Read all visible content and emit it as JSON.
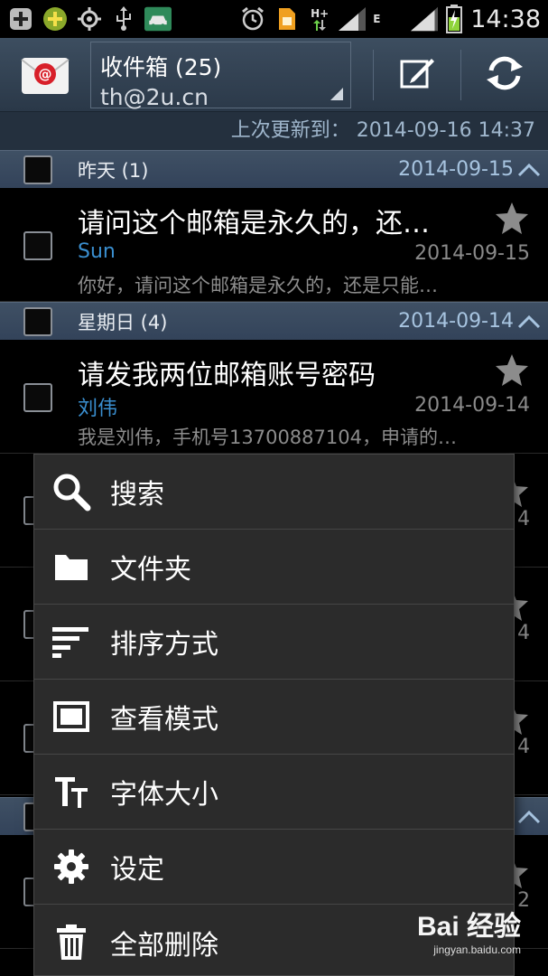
{
  "status_bar": {
    "time": "14:38",
    "network_type": "H+",
    "network_type2": "E"
  },
  "header": {
    "folder_title": "收件箱 (25)",
    "email": "th@2u.cn"
  },
  "last_updated": "上次更新到： 2014-09-16 14:37",
  "groups": [
    {
      "label": "昨天 (1)",
      "date": "2014-09-15"
    },
    {
      "label": "星期日 (4)",
      "date": "2014-09-14"
    }
  ],
  "mails": [
    {
      "subject": "请问这个邮箱是永久的，还…",
      "sender": "Sun",
      "date": "2014-09-15",
      "preview": "你好，请问这个邮箱是永久的，还是只能…"
    },
    {
      "subject": "请发我两位邮箱账号密码",
      "sender": "刘伟",
      "date": "2014-09-14",
      "preview": "我是刘伟，手机号13700887104，申请的…"
    }
  ],
  "background_rows": [
    {
      "digit": "4"
    },
    {
      "digit": "4"
    },
    {
      "digit": "4"
    },
    {
      "digit": "2"
    }
  ],
  "menu": {
    "items": [
      {
        "label": "搜索",
        "icon": "search-icon"
      },
      {
        "label": "文件夹",
        "icon": "folder-icon"
      },
      {
        "label": "排序方式",
        "icon": "sort-icon"
      },
      {
        "label": "查看模式",
        "icon": "view-mode-icon"
      },
      {
        "label": "字体大小",
        "icon": "font-size-icon"
      },
      {
        "label": "设定",
        "icon": "gear-icon"
      },
      {
        "label": "全部删除",
        "icon": "trash-icon"
      }
    ]
  },
  "watermark": {
    "brand": "Bai 经验",
    "url": "jingyan.baidu.com"
  },
  "colors": {
    "action_bar": "#33435a",
    "group_header": "#3f5064",
    "sender": "#3a8fd0",
    "date_accent": "#a7c4e0",
    "menu_bg": "#2b2b2b"
  }
}
